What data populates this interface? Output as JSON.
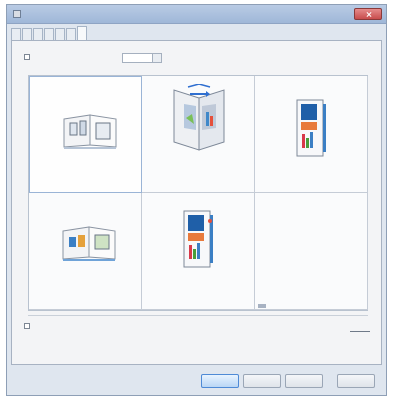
{
  "window": {
    "title": "",
    "colors": {
      "titlebar": "#a9bfde",
      "close": "#c84c4c",
      "frame": "#dfe6ef",
      "accent": "#2f6fd0"
    }
  },
  "tabs": [
    {
      "label": "",
      "active": false
    },
    {
      "label": "",
      "active": false
    },
    {
      "label": "",
      "active": false
    },
    {
      "label": "",
      "active": false
    },
    {
      "label": "",
      "active": false
    },
    {
      "label": "",
      "active": false
    },
    {
      "label": "",
      "active": true
    }
  ],
  "options": {
    "top_checkbox_label": "",
    "top_checkbox_checked": false,
    "spin_value": "",
    "spin_unit_label": "",
    "bottom_checkbox_label": "",
    "bottom_checkbox_checked": false,
    "more_button_label": ""
  },
  "presets": [
    {
      "label": "",
      "icon": "booklet-two-up-icon",
      "selected": true
    },
    {
      "label": "",
      "icon": "open-book-icon",
      "selected": false
    },
    {
      "label": "",
      "icon": "booklet-single-icon",
      "selected": false
    },
    {
      "label": "",
      "icon": "booklet-two-up-icon",
      "selected": false
    },
    {
      "label": "",
      "icon": "booklet-single-icon",
      "selected": false
    },
    {
      "label": "",
      "icon": "",
      "selected": false
    }
  ],
  "buttons": {
    "ok": "",
    "cancel": "",
    "apply": "",
    "help": ""
  }
}
